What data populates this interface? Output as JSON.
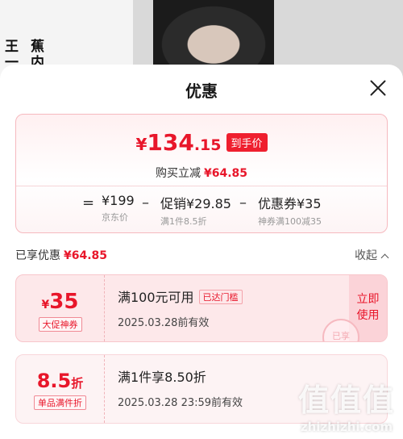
{
  "background": {
    "name_col1": "王一",
    "name_col2": "蕉内"
  },
  "sheet": {
    "title": "优惠",
    "close_icon": "close-icon"
  },
  "summary": {
    "currency": "¥",
    "price_int": "134",
    "price_dec": ".15",
    "price_tag": "到手价",
    "save_label": "购买立减",
    "save_amount": "¥64.85",
    "calc": [
      {
        "main": "¥199",
        "sub": "京东价"
      },
      {
        "main": "促销¥29.85",
        "sub": "满1件8.5折"
      },
      {
        "main": "优惠券¥35",
        "sub": "神券满100减35"
      }
    ],
    "ops": [
      "=",
      "–",
      "–"
    ]
  },
  "enjoy": {
    "label": "已享优惠",
    "amount": "¥64.85",
    "collapse_label": "收起",
    "collapse_icon": "chevron-up-icon"
  },
  "coupons": [
    {
      "value_prefix": "¥",
      "value": "35",
      "value_suffix": "",
      "tag": "大促神券",
      "title": "满100元可用",
      "badge": "已达门槛",
      "date": "2025.03.28前有效",
      "action": "立即使用",
      "stamp": "已享"
    },
    {
      "value_prefix": "",
      "value": "8.5",
      "value_suffix": "折",
      "tag": "单品满件折",
      "title": "满1件享8.50折",
      "date": "2025.03.28  23:59前有效"
    }
  ],
  "watermark": {
    "glyphs": "值值值",
    "text": "zhizhizhi.com"
  },
  "colors": {
    "accent": "#e8162a",
    "tag_bg": "#ef1f2e",
    "coupon_bg": "#fde8ea"
  }
}
